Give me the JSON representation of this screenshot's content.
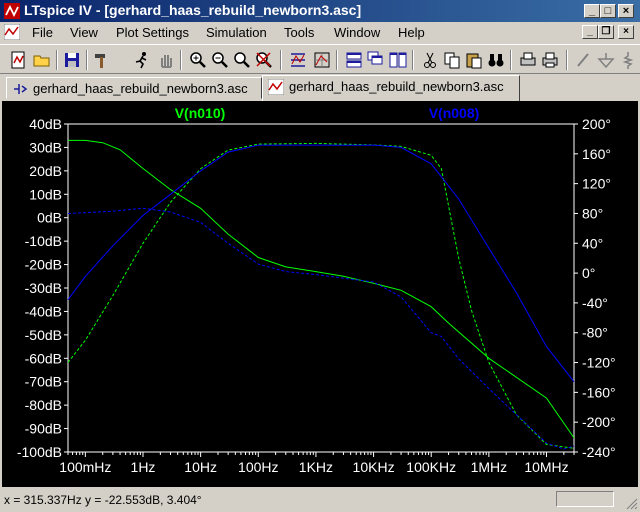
{
  "window": {
    "title": "LTspice IV - [gerhard_haas_rebuild_newborn3.asc]"
  },
  "menu": [
    "File",
    "View",
    "Plot Settings",
    "Simulation",
    "Tools",
    "Window",
    "Help"
  ],
  "tabs": [
    {
      "label": "gerhard_haas_rebuild_newborn3.asc",
      "type": "schematic",
      "active": false
    },
    {
      "label": "gerhard_haas_rebuild_newborn3.asc",
      "type": "waveform",
      "active": true
    }
  ],
  "status": {
    "text": "x = 315.337Hz   y = -22.553dB, 3.404°"
  },
  "colors": {
    "trace_n010": "#00ff00",
    "trace_n008": "#0000ff",
    "plot_bg": "#000000",
    "axis_text": "#ffffff"
  },
  "chart_data": {
    "type": "line",
    "x_scale": "log",
    "xlim": [
      0.05,
      30000000
    ],
    "x_ticks": [
      {
        "value": 0.1,
        "label": "100mHz"
      },
      {
        "value": 1,
        "label": "1Hz"
      },
      {
        "value": 10,
        "label": "10Hz"
      },
      {
        "value": 100,
        "label": "100Hz"
      },
      {
        "value": 1000,
        "label": "1KHz"
      },
      {
        "value": 10000,
        "label": "10KHz"
      },
      {
        "value": 100000,
        "label": "100KHz"
      },
      {
        "value": 1000000,
        "label": "1MHz"
      },
      {
        "value": 10000000,
        "label": "10MHz"
      }
    ],
    "y_left": {
      "range": [
        -100,
        40
      ],
      "ticks": [
        "40dB",
        "30dB",
        "20dB",
        "10dB",
        "0dB",
        "-10dB",
        "-20dB",
        "-30dB",
        "-40dB",
        "-50dB",
        "-60dB",
        "-70dB",
        "-80dB",
        "-90dB",
        "-100dB"
      ],
      "tick_values": [
        40,
        30,
        20,
        10,
        0,
        -10,
        -20,
        -30,
        -40,
        -50,
        -60,
        -70,
        -80,
        -90,
        -100
      ]
    },
    "y_right": {
      "range": [
        -240,
        200
      ],
      "ticks": [
        "200°",
        "160°",
        "120°",
        "80°",
        "40°",
        "0°",
        "-40°",
        "-80°",
        "-120°",
        "-160°",
        "-200°",
        "-240°"
      ],
      "tick_values": [
        200,
        160,
        120,
        80,
        40,
        0,
        -40,
        -80,
        -120,
        -160,
        -200,
        -240
      ]
    },
    "series": [
      {
        "name": "V(n010)",
        "color": "#00ff00",
        "magnitude_db": [
          [
            0.05,
            33
          ],
          [
            0.1,
            33
          ],
          [
            0.2,
            32
          ],
          [
            0.4,
            29
          ],
          [
            1,
            21
          ],
          [
            3,
            12
          ],
          [
            10,
            4
          ],
          [
            30,
            -7
          ],
          [
            100,
            -17
          ],
          [
            300,
            -21
          ],
          [
            1000,
            -23
          ],
          [
            3000,
            -25
          ],
          [
            10000,
            -28
          ],
          [
            30000,
            -31
          ],
          [
            100000,
            -38
          ],
          [
            200000,
            -45
          ],
          [
            1000000,
            -60
          ],
          [
            10000000,
            -77
          ],
          [
            30000000,
            -94
          ]
        ],
        "phase_deg": [
          [
            0.05,
            -120
          ],
          [
            0.1,
            -90
          ],
          [
            0.3,
            -30
          ],
          [
            1,
            40
          ],
          [
            3,
            95
          ],
          [
            10,
            140
          ],
          [
            30,
            165
          ],
          [
            100,
            173
          ],
          [
            1000,
            174
          ],
          [
            10000,
            172
          ],
          [
            30000,
            170
          ],
          [
            100000,
            158
          ],
          [
            150000,
            140
          ],
          [
            200000,
            90
          ],
          [
            300000,
            20
          ],
          [
            500000,
            -50
          ],
          [
            1000000,
            -120
          ],
          [
            3000000,
            -190
          ],
          [
            10000000,
            -230
          ],
          [
            30000000,
            -235
          ]
        ]
      },
      {
        "name": "V(n008)",
        "color": "#0000ff",
        "magnitude_db": [
          [
            0.05,
            -35
          ],
          [
            0.1,
            -25
          ],
          [
            0.3,
            -12
          ],
          [
            1,
            1
          ],
          [
            3,
            10
          ],
          [
            10,
            20
          ],
          [
            30,
            28
          ],
          [
            100,
            31
          ],
          [
            1000,
            31
          ],
          [
            10000,
            31
          ],
          [
            30000,
            30
          ],
          [
            100000,
            23
          ],
          [
            300000,
            8
          ],
          [
            1000000,
            -13
          ],
          [
            3000000,
            -32
          ],
          [
            10000000,
            -55
          ],
          [
            30000000,
            -70
          ]
        ],
        "phase_deg": [
          [
            0.05,
            80
          ],
          [
            0.3,
            83
          ],
          [
            1,
            87
          ],
          [
            3,
            82
          ],
          [
            10,
            68
          ],
          [
            30,
            40
          ],
          [
            100,
            12
          ],
          [
            300,
            2
          ],
          [
            1000,
            -2
          ],
          [
            10000,
            -12
          ],
          [
            30000,
            -32
          ],
          [
            100000,
            -80
          ],
          [
            150000,
            -85
          ],
          [
            300000,
            -115
          ],
          [
            1000000,
            -155
          ],
          [
            3000000,
            -190
          ],
          [
            10000000,
            -228
          ],
          [
            20000000,
            -236
          ],
          [
            30000000,
            -232
          ]
        ]
      }
    ]
  }
}
